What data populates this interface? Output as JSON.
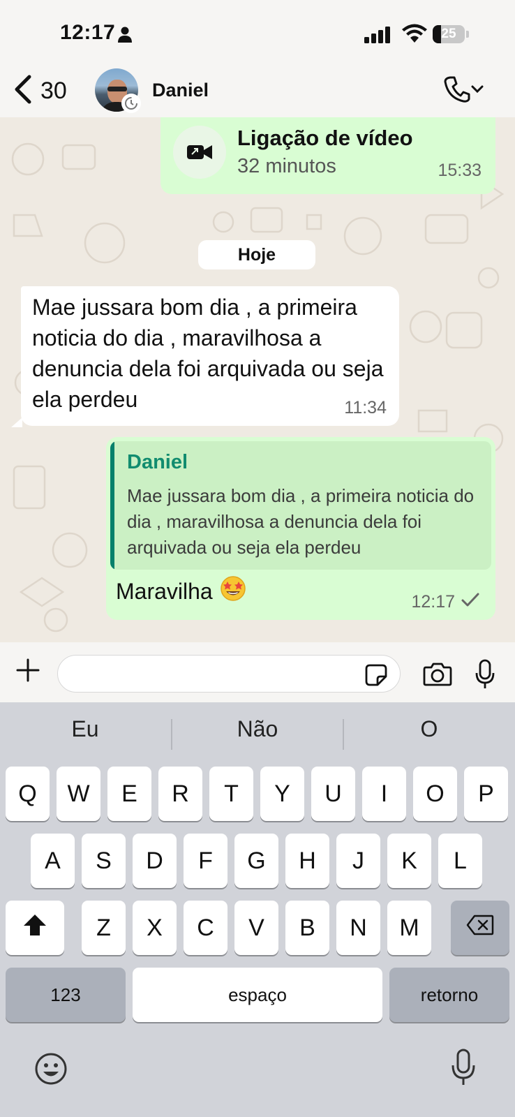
{
  "status_bar": {
    "time": "12:17",
    "battery": "25"
  },
  "header": {
    "back_count": "30",
    "contact_name": "Daniel"
  },
  "call_message": {
    "title": "Ligação de vídeo",
    "duration": "32 minutos",
    "time": "15:33"
  },
  "date_chip": "Hoje",
  "incoming_message": {
    "text": "Mae jussara bom dia , a primeira noticia do dia , maravilhosa a denuncia dela foi arquivada ou seja ela perdeu",
    "time": "11:34"
  },
  "reply_message": {
    "quoted_name": "Daniel",
    "quoted_text": "Mae jussara bom dia , a primeira noticia do dia , maravilhosa a denuncia dela foi arquivada ou seja ela perdeu",
    "text": "Maravilha",
    "time": "12:17",
    "status": "sent-check"
  },
  "input": {
    "placeholder": ""
  },
  "keyboard": {
    "suggestions": [
      "Eu",
      "Não",
      "O"
    ],
    "row1": [
      "Q",
      "W",
      "E",
      "R",
      "T",
      "Y",
      "U",
      "I",
      "O",
      "P"
    ],
    "row2": [
      "A",
      "S",
      "D",
      "F",
      "G",
      "H",
      "J",
      "K",
      "L"
    ],
    "row3": [
      "Z",
      "X",
      "C",
      "V",
      "B",
      "N",
      "M"
    ],
    "numbers_label": "123",
    "space_label": "espaço",
    "return_label": "retorno"
  },
  "colors": {
    "outgoing_bubble": "#d9fdd3",
    "incoming_bubble": "#ffffff",
    "chat_bg": "#efeae2",
    "accent": "#118c6f",
    "keyboard_bg": "#d1d3d9"
  }
}
